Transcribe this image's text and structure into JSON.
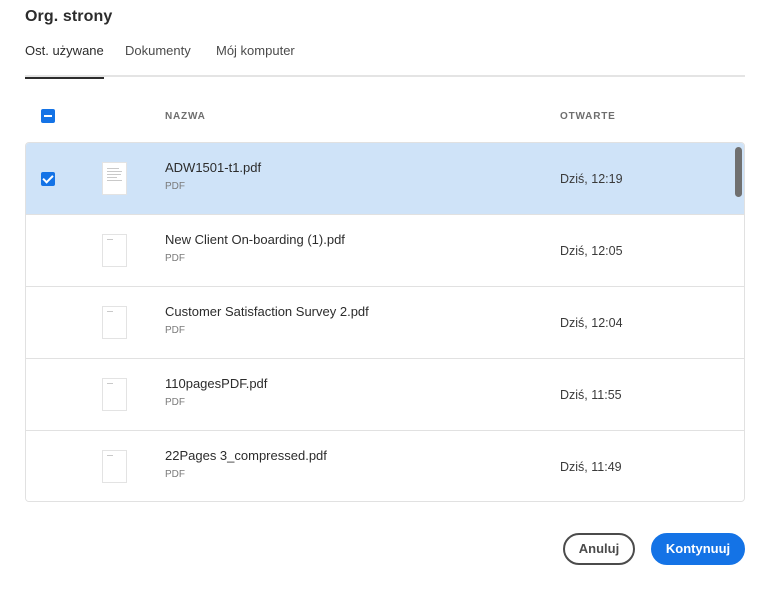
{
  "dialog": {
    "title": "Org. strony"
  },
  "tabs": [
    {
      "label": "Ost. używane",
      "active": true
    },
    {
      "label": "Dokumenty",
      "active": false
    },
    {
      "label": "Mój komputer",
      "active": false
    }
  ],
  "table": {
    "columns": {
      "name": "NAZWA",
      "opened": "OTWARTE"
    },
    "rows": [
      {
        "name": "ADW1501-t1.pdf",
        "type": "PDF",
        "opened": "Dziś, 12:19",
        "selected": true
      },
      {
        "name": "New Client On-boarding (1).pdf",
        "type": "PDF",
        "opened": "Dziś, 12:05",
        "selected": false
      },
      {
        "name": "Customer Satisfaction Survey 2.pdf",
        "type": "PDF",
        "opened": "Dziś, 12:04",
        "selected": false
      },
      {
        "name": "110pagesPDF.pdf",
        "type": "PDF",
        "opened": "Dziś, 11:55",
        "selected": false
      },
      {
        "name": "22Pages 3_compressed.pdf",
        "type": "PDF",
        "opened": "Dziś, 11:49",
        "selected": false
      }
    ]
  },
  "buttons": {
    "cancel": "Anuluj",
    "continue": "Kontynuuj"
  },
  "colors": {
    "accent": "#1473e6",
    "selected_row": "#cfe3f8"
  },
  "icons": {
    "header_checkbox": "indeterminate-checkbox-icon",
    "row_checkbox": "checked-checkbox-icon",
    "thumbnail": "pdf-thumbnail-icon"
  }
}
